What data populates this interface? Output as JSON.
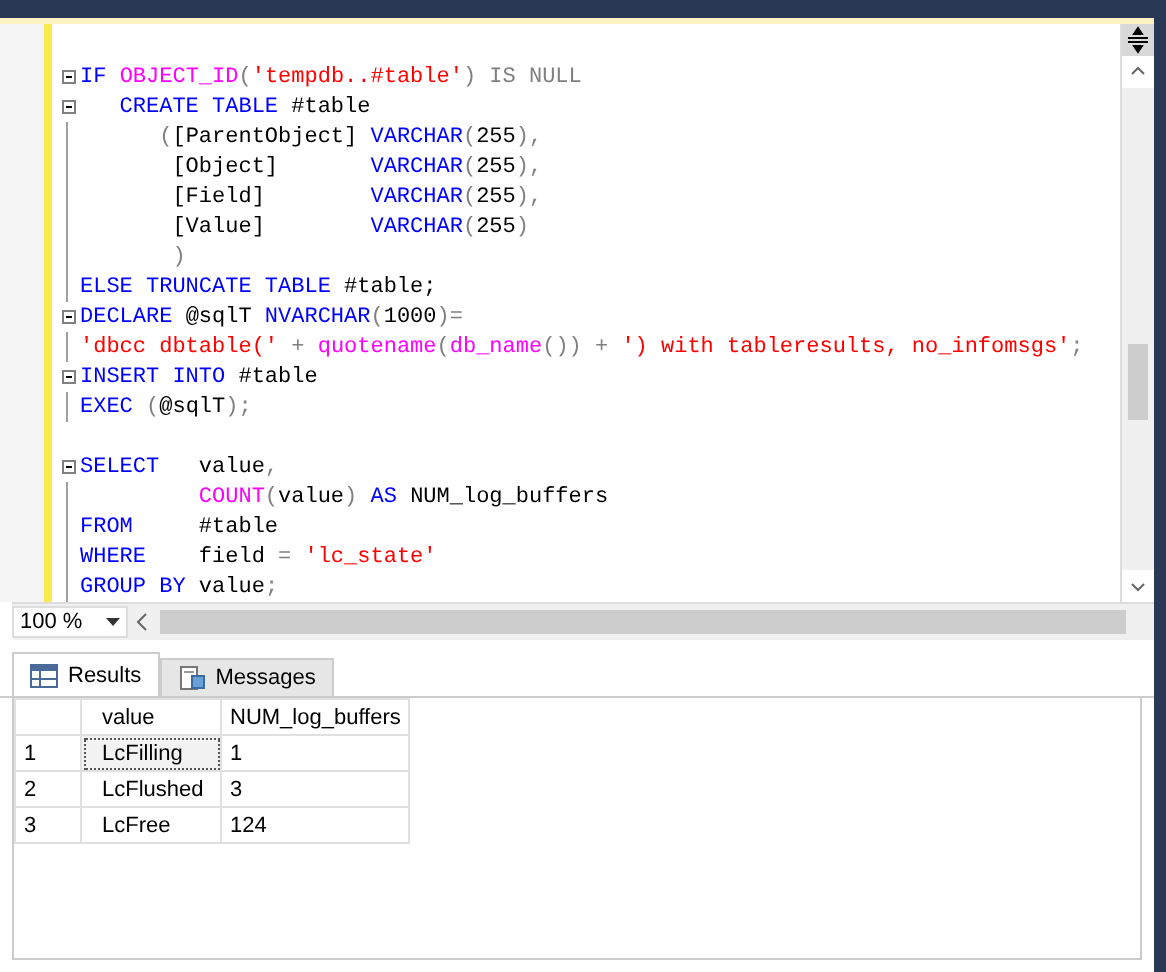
{
  "editor": {
    "lines": [
      {
        "fold": false
      },
      {
        "fold": true,
        "tokens": [
          {
            "kind": "keyword",
            "t": "IF "
          },
          {
            "kind": "function",
            "t": "OBJECT_ID"
          },
          {
            "kind": "operator",
            "t": "("
          },
          {
            "kind": "string",
            "t": "'tempdb..#table'"
          },
          {
            "kind": "operator",
            "t": ") IS NULL"
          }
        ]
      },
      {
        "fold": true,
        "tokens": [
          {
            "kind": "keyword",
            "t": "   CREATE TABLE "
          },
          {
            "kind": "text",
            "t": "#table"
          }
        ]
      },
      {
        "fold": false,
        "tokens": [
          {
            "kind": "operator",
            "t": "      ("
          },
          {
            "kind": "text",
            "t": "[ParentObject] "
          },
          {
            "kind": "keyword",
            "t": "VARCHAR"
          },
          {
            "kind": "operator",
            "t": "("
          },
          {
            "kind": "text",
            "t": "255"
          },
          {
            "kind": "operator",
            "t": "),"
          }
        ]
      },
      {
        "fold": false,
        "tokens": [
          {
            "kind": "text",
            "t": "       [Object]       "
          },
          {
            "kind": "keyword",
            "t": "VARCHAR"
          },
          {
            "kind": "operator",
            "t": "("
          },
          {
            "kind": "text",
            "t": "255"
          },
          {
            "kind": "operator",
            "t": "),"
          }
        ]
      },
      {
        "fold": false,
        "tokens": [
          {
            "kind": "text",
            "t": "       [Field]        "
          },
          {
            "kind": "keyword",
            "t": "VARCHAR"
          },
          {
            "kind": "operator",
            "t": "("
          },
          {
            "kind": "text",
            "t": "255"
          },
          {
            "kind": "operator",
            "t": "),"
          }
        ]
      },
      {
        "fold": false,
        "tokens": [
          {
            "kind": "text",
            "t": "       [Value]        "
          },
          {
            "kind": "keyword",
            "t": "VARCHAR"
          },
          {
            "kind": "operator",
            "t": "("
          },
          {
            "kind": "text",
            "t": "255"
          },
          {
            "kind": "operator",
            "t": ")"
          }
        ]
      },
      {
        "fold": false,
        "tokens": [
          {
            "kind": "operator",
            "t": "       )"
          }
        ]
      },
      {
        "fold": false,
        "tokens": [
          {
            "kind": "keyword",
            "t": "ELSE TRUNCATE TABLE "
          },
          {
            "kind": "text",
            "t": "#table;"
          }
        ]
      },
      {
        "fold": true,
        "tokens": [
          {
            "kind": "keyword",
            "t": "DECLARE "
          },
          {
            "kind": "text",
            "t": "@sqlT "
          },
          {
            "kind": "keyword",
            "t": "NVARCHAR"
          },
          {
            "kind": "operator",
            "t": "("
          },
          {
            "kind": "text",
            "t": "1000"
          },
          {
            "kind": "operator",
            "t": ")="
          }
        ]
      },
      {
        "fold": false,
        "tokens": [
          {
            "kind": "string",
            "t": "'dbcc dbtable('"
          },
          {
            "kind": "operator",
            "t": " + "
          },
          {
            "kind": "function",
            "t": "quotename"
          },
          {
            "kind": "operator",
            "t": "("
          },
          {
            "kind": "function",
            "t": "db_name"
          },
          {
            "kind": "operator",
            "t": "()) + "
          },
          {
            "kind": "string",
            "t": "') with tableresults, no_infomsgs'"
          },
          {
            "kind": "operator",
            "t": ";"
          }
        ]
      },
      {
        "fold": true,
        "tokens": [
          {
            "kind": "keyword",
            "t": "INSERT INTO "
          },
          {
            "kind": "text",
            "t": "#table"
          }
        ]
      },
      {
        "fold": false,
        "tokens": [
          {
            "kind": "keyword",
            "t": "EXEC "
          },
          {
            "kind": "operator",
            "t": "("
          },
          {
            "kind": "text",
            "t": "@sqlT"
          },
          {
            "kind": "operator",
            "t": ");"
          }
        ]
      },
      {
        "fold": false
      },
      {
        "fold": true,
        "tokens": [
          {
            "kind": "keyword",
            "t": "SELECT   "
          },
          {
            "kind": "text",
            "t": "value"
          },
          {
            "kind": "operator",
            "t": ","
          }
        ]
      },
      {
        "fold": false,
        "tokens": [
          {
            "kind": "function",
            "t": "         COUNT"
          },
          {
            "kind": "operator",
            "t": "("
          },
          {
            "kind": "text",
            "t": "value"
          },
          {
            "kind": "operator",
            "t": ") "
          },
          {
            "kind": "keyword",
            "t": "AS "
          },
          {
            "kind": "text",
            "t": "NUM_log_buffers"
          }
        ]
      },
      {
        "fold": false,
        "tokens": [
          {
            "kind": "keyword",
            "t": "FROM     "
          },
          {
            "kind": "text",
            "t": "#table"
          }
        ]
      },
      {
        "fold": false,
        "tokens": [
          {
            "kind": "keyword",
            "t": "WHERE    "
          },
          {
            "kind": "text",
            "t": "field "
          },
          {
            "kind": "operator",
            "t": "= "
          },
          {
            "kind": "string",
            "t": "'lc_state'"
          }
        ]
      },
      {
        "fold": false,
        "tokens": [
          {
            "kind": "keyword",
            "t": "GROUP BY "
          },
          {
            "kind": "text",
            "t": "value"
          },
          {
            "kind": "operator",
            "t": ";"
          }
        ]
      }
    ]
  },
  "zoom": "100 %",
  "result_tabs": [
    {
      "label": "Results",
      "selected": true
    },
    {
      "label": "Messages",
      "selected": false
    }
  ],
  "grid": {
    "columns": [
      "value",
      "NUM_log_buffers"
    ],
    "rows": [
      {
        "number": "1",
        "cells": [
          "LcFilling",
          "1"
        ]
      },
      {
        "number": "2",
        "cells": [
          "LcFlushed",
          "3"
        ]
      },
      {
        "number": "3",
        "cells": [
          "LcFree",
          "124"
        ]
      }
    ]
  }
}
